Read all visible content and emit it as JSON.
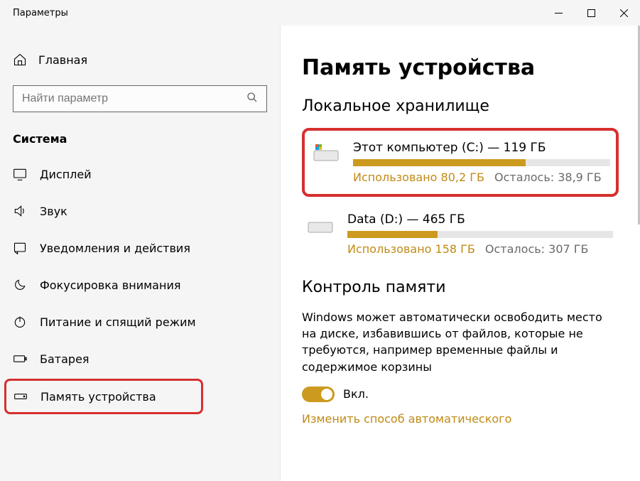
{
  "window": {
    "title": "Параметры"
  },
  "sidebar": {
    "home": "Главная",
    "search_placeholder": "Найти параметр",
    "category": "Система",
    "items": [
      {
        "label": "Дисплей"
      },
      {
        "label": "Звук"
      },
      {
        "label": "Уведомления и действия"
      },
      {
        "label": "Фокусировка внимания"
      },
      {
        "label": "Питание и спящий режим"
      },
      {
        "label": "Батарея"
      },
      {
        "label": "Память устройства"
      }
    ]
  },
  "main": {
    "title": "Память устройства",
    "local_storage_title": "Локальное хранилище",
    "drives": [
      {
        "name": "Этот компьютер (C:) — 119 ГБ",
        "used_label": "Использовано 80,2 ГБ",
        "free_label": "Осталось: 38,9 ГБ",
        "fill_percent": 67
      },
      {
        "name": "Data (D:) — 465 ГБ",
        "used_label": "Использовано 158 ГБ",
        "free_label": "Осталось: 307 ГБ",
        "fill_percent": 34
      }
    ],
    "sense_title": "Контроль памяти",
    "sense_desc": "Windows может автоматически освободить место на диске, избавившись от файлов, которые не требуются, например временные файлы и содержимое корзины",
    "toggle_state": "Вкл.",
    "link": "Изменить способ автоматического"
  }
}
